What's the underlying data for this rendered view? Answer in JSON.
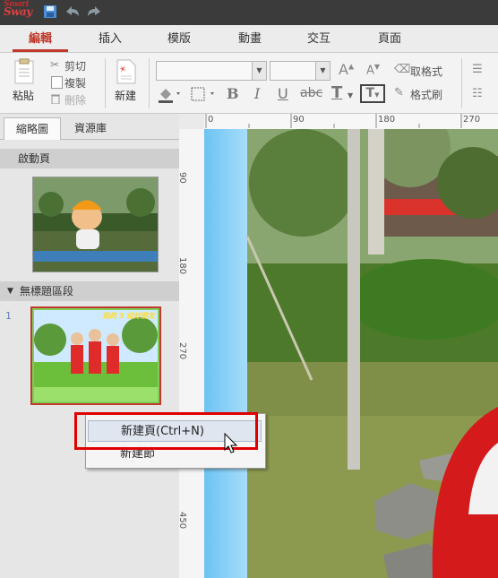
{
  "app": {
    "logo_text": "Sway",
    "logo_super": "Smart"
  },
  "menu_tabs": [
    "編輯",
    "插入",
    "模版",
    "動畫",
    "交互",
    "頁面"
  ],
  "ribbon": {
    "paste": "粘貼",
    "cut": "剪切",
    "copy": "複製",
    "delete": "刪除",
    "new": "新建",
    "clear_format": "取格式",
    "format_brush": "格式刷"
  },
  "left_panel": {
    "tabs": [
      "縮略圖",
      "資源庫"
    ],
    "startup_page": "啟動頁",
    "section_title": "無標題區段",
    "slide_number": "1",
    "slide_caption": "我的 3 位好朋友"
  },
  "ruler": {
    "h_ticks": [
      "0",
      "90",
      "180",
      "270"
    ],
    "v_ticks": [
      "90",
      "180",
      "270",
      "450"
    ]
  },
  "context_menu": {
    "items": [
      "新建頁(Ctrl+N)",
      "新建節"
    ]
  },
  "colors": {
    "accent": "#c0392b",
    "highlight": "#e00000"
  }
}
